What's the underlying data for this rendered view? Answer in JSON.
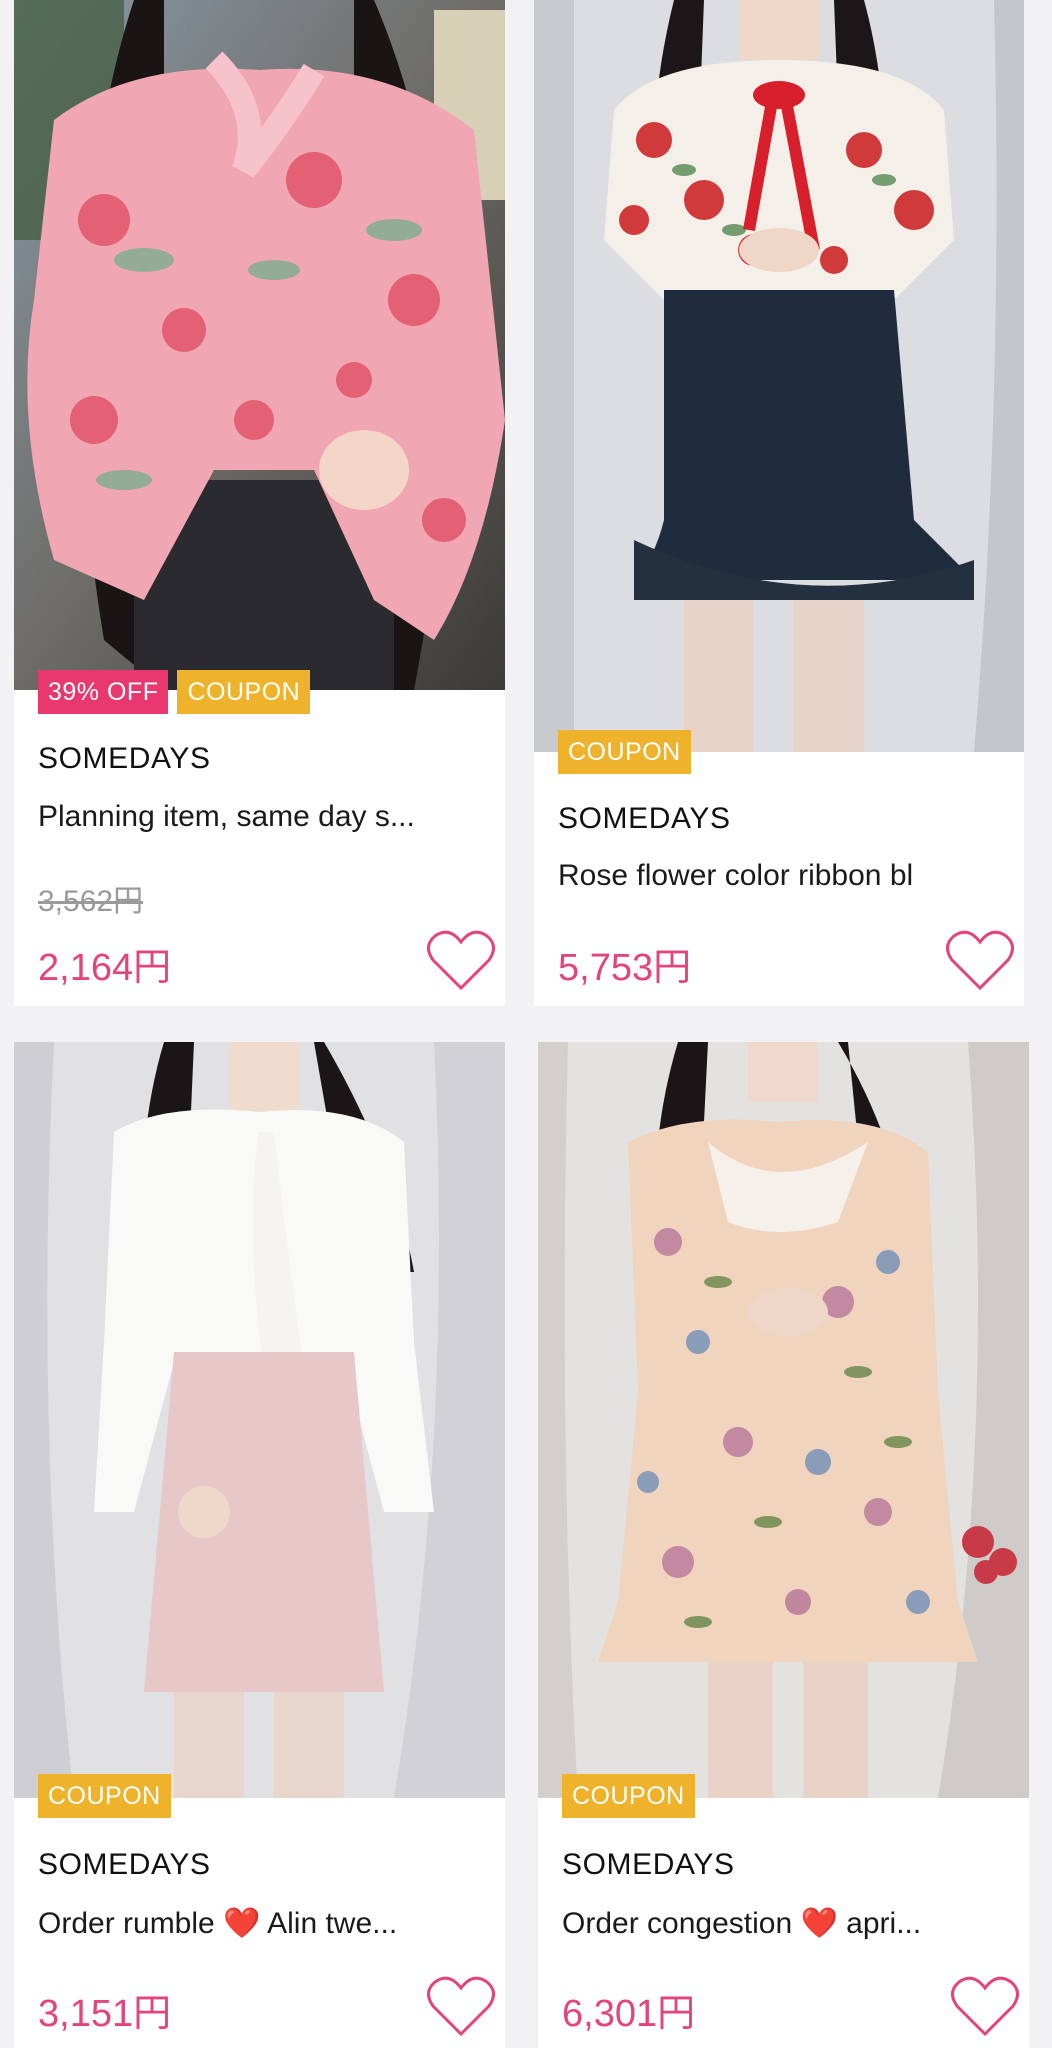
{
  "products": [
    {
      "discount_badge": "39% OFF",
      "coupon_badge": "COUPON",
      "brand": "SOMEDAYS",
      "title": "Planning item, same day s...",
      "original_price": "3,562円",
      "price": "2,164円",
      "favorite_icon": "heart-outline-icon"
    },
    {
      "coupon_badge": "COUPON",
      "brand": "SOMEDAYS",
      "title": "Rose flower color ribbon bl",
      "price": "5,753円",
      "favorite_icon": "heart-outline-icon"
    },
    {
      "coupon_badge": "COUPON",
      "brand": "SOMEDAYS",
      "title_before": "Order rumble ",
      "title_emoji": "❤️",
      "title_after": " Alin twe...",
      "price": "3,151円",
      "favorite_icon": "heart-outline-icon"
    },
    {
      "coupon_badge": "COUPON",
      "brand": "SOMEDAYS",
      "title_before": "Order congestion ",
      "title_emoji": "❤️",
      "title_after": " apri...",
      "price": "6,301円",
      "favorite_icon": "heart-outline-icon"
    }
  ],
  "colors": {
    "price_pink": "#e4447c",
    "discount_badge": "#e8386d",
    "coupon_badge": "#efb22b",
    "heart_outline": "#e4447c",
    "page_background": "#f2f1f4"
  }
}
